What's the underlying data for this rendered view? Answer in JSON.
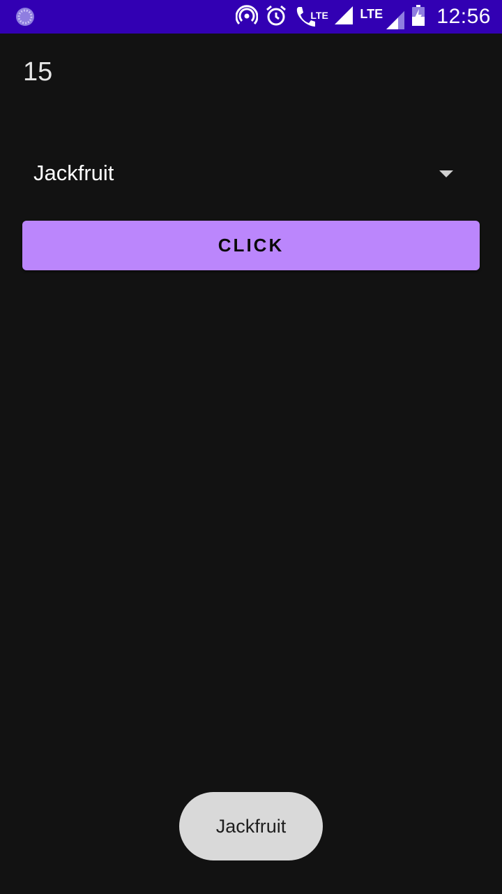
{
  "status_bar": {
    "time": "12:56",
    "lte_call_label": "LTE",
    "lte_signal_label": "LTE",
    "background_color": "#3200b3",
    "icons": [
      "loading-icon",
      "hotspot-icon",
      "alarm-icon",
      "volte-call-icon",
      "signal-icon",
      "lte-signal-icon",
      "battery-charging-icon"
    ]
  },
  "main": {
    "counter_value": "15",
    "spinner": {
      "selected_value": "Jackfruit"
    },
    "button": {
      "label": "CLICK",
      "color": "#bb86fc"
    }
  },
  "toast": {
    "message": "Jackfruit"
  }
}
